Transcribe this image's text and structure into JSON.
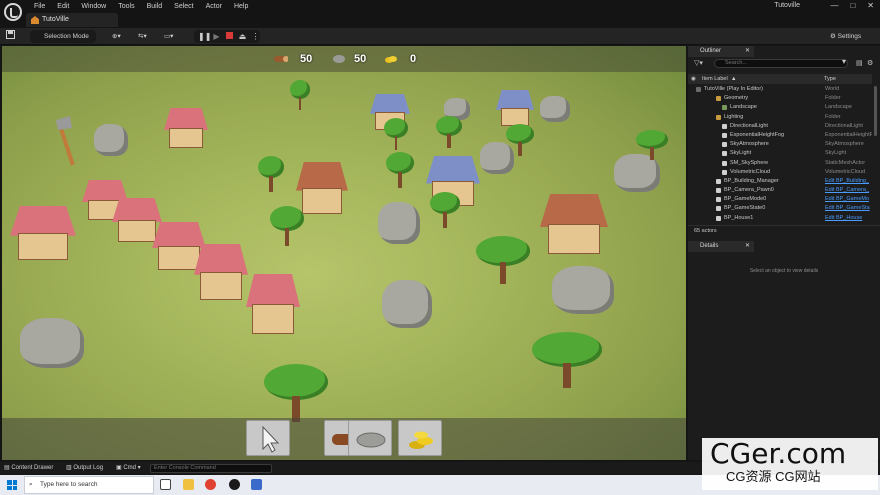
{
  "menubar": {
    "items": [
      "File",
      "Edit",
      "Window",
      "Tools",
      "Build",
      "Select",
      "Actor",
      "Help"
    ],
    "project_name": "Tutoville",
    "doc_tab": "TutoVille",
    "win_minimize": "—",
    "win_maximize": "□",
    "win_close": "✕"
  },
  "toolbar": {
    "selection_mode": "Selection Mode",
    "settings": "Settings"
  },
  "hud": {
    "wood": "50",
    "stone": "50",
    "gold": "0"
  },
  "build_menu": [
    "cursor-tool",
    "wood-log",
    "stone",
    "gold-coins"
  ],
  "outliner": {
    "tab": "Outliner",
    "search_placeholder": "Search...",
    "col_label": "Item Label",
    "col_type": "Type",
    "rows": [
      {
        "label": "TutoVille (Play In Editor)",
        "type": "World"
      },
      {
        "label": "Geometry",
        "type": "Folder"
      },
      {
        "label": "Landscape",
        "type": "Landscape"
      },
      {
        "label": "Lighting",
        "type": "Folder"
      },
      {
        "label": "DirectionalLight",
        "type": "DirectionalLight"
      },
      {
        "label": "ExponentialHeightFog",
        "type": "ExponentialHeightFog"
      },
      {
        "label": "SkyAtmosphere",
        "type": "SkyAtmosphere"
      },
      {
        "label": "SkyLight",
        "type": "SkyLight"
      },
      {
        "label": "SM_SkySphere",
        "type": "StaticMeshActor"
      },
      {
        "label": "VolumetricCloud",
        "type": "VolumetricCloud"
      },
      {
        "label": "BP_Building_Manager",
        "type": "Edit BP_Building_"
      },
      {
        "label": "BP_Camera_Pawn0",
        "type": "Edit BP_Camera_"
      },
      {
        "label": "BP_GameMode0",
        "type": "Edit BP_GameMo"
      },
      {
        "label": "BP_GameState0",
        "type": "Edit BP_GameSta"
      },
      {
        "label": "BP_House1",
        "type": "Edit BP_House"
      }
    ],
    "actor_count": "65 actors"
  },
  "details": {
    "tab": "Details",
    "empty_message": "Select an object to view details"
  },
  "statusbar": {
    "content_drawer": "Content Drawer",
    "output_log": "Output Log",
    "cmd": "Cmd",
    "console_placeholder": "Enter Console Command"
  },
  "taskbar": {
    "search_placeholder": "Type here to search"
  },
  "watermark": {
    "main": "CGer.com",
    "sub": "CG资源 CG网站"
  },
  "colors": {
    "accent_blue": "#0078d4",
    "link_blue": "#4a9cff",
    "stop_red": "#d83a3a",
    "grass": "#a3b55a"
  }
}
